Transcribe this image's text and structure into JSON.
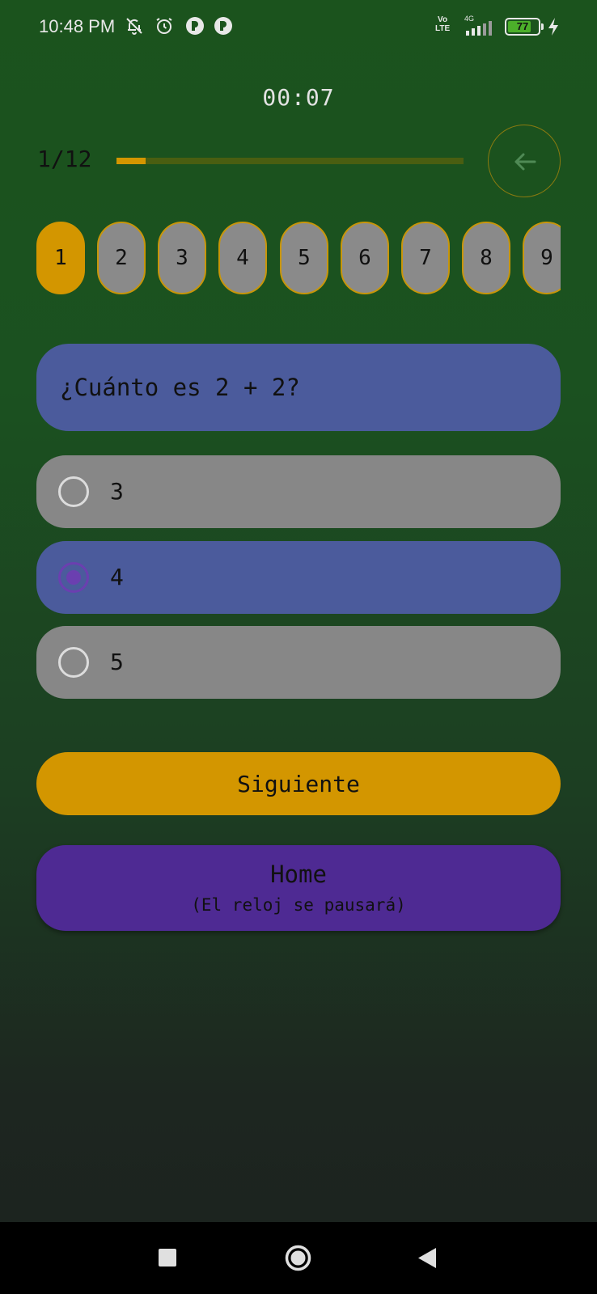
{
  "status_bar": {
    "time": "10:48 PM",
    "icons": [
      "mute-icon",
      "alarm-icon",
      "app-notification-icon",
      "app-notification-icon"
    ],
    "volte_line1": "Vo",
    "volte_line2": "LTE",
    "network": "4G",
    "battery": "77",
    "battery_level": 0.77,
    "charging": true
  },
  "quiz": {
    "timer": "00:07",
    "counter": "1/12",
    "progress": 0.083,
    "back_icon": "arrow-left-icon"
  },
  "pills": [
    "1",
    "2",
    "3",
    "4",
    "5",
    "6",
    "7",
    "8",
    "9"
  ],
  "active_pill": 0,
  "question": {
    "text": "¿Cuánto es 2 + 2?"
  },
  "options": [
    {
      "label": "3",
      "selected": false
    },
    {
      "label": "4",
      "selected": true
    },
    {
      "label": "5",
      "selected": false
    }
  ],
  "buttons": {
    "next_label": "Siguiente",
    "home_label": "Home",
    "home_sublabel": "(El reloj se pausará)"
  },
  "colors": {
    "accent": "#d39600",
    "question_bg": "#4b5b9c",
    "option_bg": "#878787",
    "home_bg": "#4e2a93",
    "radio_selected": "#6b3fb0"
  },
  "nav_bar": [
    "recents-icon",
    "home-icon",
    "back-icon"
  ]
}
